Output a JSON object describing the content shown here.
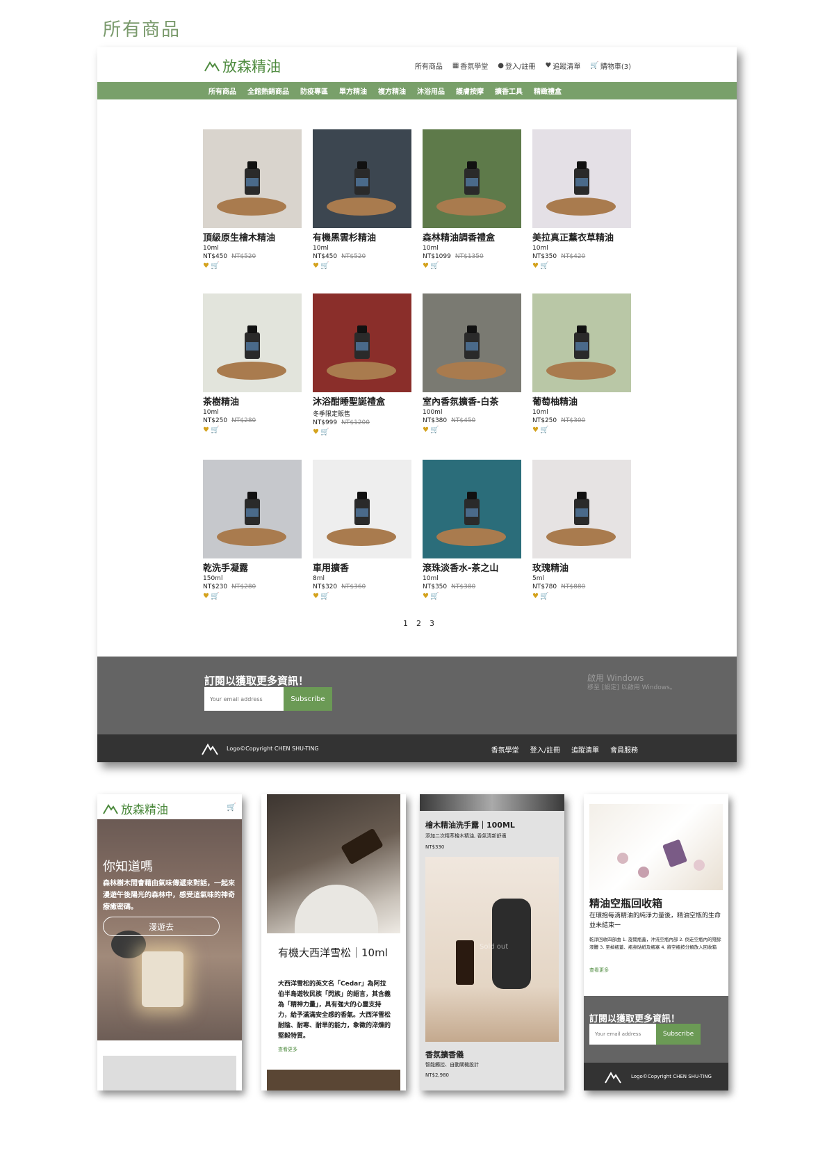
{
  "heading": "所有商品",
  "brand": {
    "logo_text": "放森精油",
    "accent": "#79a06a",
    "logo_color": "#4d8a3e"
  },
  "desktop": {
    "top_links": [
      {
        "label": "所有商品",
        "icon": ""
      },
      {
        "label": "香氛學堂",
        "icon": "store-icon"
      },
      {
        "label": "登入/註冊",
        "icon": "user-icon"
      },
      {
        "label": "追蹤清單",
        "icon": "heart-icon"
      },
      {
        "label": "購物車(3)",
        "icon": "cart-icon"
      }
    ],
    "categories": [
      "所有商品",
      "全館熱銷商品",
      "防疫專區",
      "單方精油",
      "複方精油",
      "沐浴用品",
      "護膚按摩",
      "擴香工具",
      "精緻禮盒"
    ],
    "products": [
      {
        "name": "頂級原生檜木精油",
        "size": "10ml",
        "price": "NT$450",
        "old_price": "NT$520",
        "bg": "#d9d4cd"
      },
      {
        "name": "有機黑雲杉精油",
        "size": "10ml",
        "price": "NT$450",
        "old_price": "NT$520",
        "bg": "#3c4650"
      },
      {
        "name": "森林精油調香禮盒",
        "size": "10ml",
        "price": "NT$1099",
        "old_price": "NT$1350",
        "bg": "#5e7a4a"
      },
      {
        "name": "美拉真正薰衣草精油",
        "size": "10ml",
        "price": "NT$350",
        "old_price": "NT$420",
        "bg": "#e4e0e6"
      },
      {
        "name": "茶樹精油",
        "size": "10ml",
        "price": "NT$250",
        "old_price": "NT$280",
        "bg": "#e2e4dc"
      },
      {
        "name": "沐浴酣睡聖誕禮盒",
        "size": "冬季限定販售",
        "price": "NT$999",
        "old_price": "NT$1200",
        "bg": "#8a2e2a"
      },
      {
        "name": "室內香氛擴香-白茶",
        "size": "100ml",
        "price": "NT$380",
        "old_price": "NT$450",
        "bg": "#7a7a72"
      },
      {
        "name": "葡萄柚精油",
        "size": "10ml",
        "price": "NT$250",
        "old_price": "NT$300",
        "bg": "#b9c7a6"
      },
      {
        "name": "乾洗手凝露",
        "size": "150ml",
        "price": "NT$230",
        "old_price": "NT$280",
        "bg": "#c6c8cc"
      },
      {
        "name": "車用擴香",
        "size": "8ml",
        "price": "NT$320",
        "old_price": "NT$360",
        "bg": "#eeeeee"
      },
      {
        "name": "滾珠淡香水-茶之山",
        "size": "10ml",
        "price": "NT$350",
        "old_price": "NT$380",
        "bg": "#2b6d7a"
      },
      {
        "name": "玫瑰精油",
        "size": "5ml",
        "price": "NT$780",
        "old_price": "NT$880",
        "bg": "#e6e3e3"
      }
    ],
    "pages": [
      "1",
      "2",
      "3"
    ],
    "subscribe": {
      "title": "訂閱以獲取更多資訊！",
      "placeholder": "Your email address",
      "button": "Subscribe"
    },
    "footer": {
      "copyright": "Logo©Copyright CHEN SHU-TING",
      "links": [
        "香氛學堂",
        "登入/註冊",
        "追蹤清單",
        "會員服務"
      ]
    },
    "watermark": {
      "line1": "啟用 Windows",
      "line2": "移至 [設定] 以啟用 Windows。"
    }
  },
  "mobile": {
    "m1": {
      "title": "你知道嗎",
      "text": "森林樹木間會藉由氣味傳遞來對話，一起來漫遊午後陽光的森林中，感受這氣味的神奇療癒密碼。",
      "button": "漫遊去"
    },
    "m2": {
      "title": "有機大西洋雪松｜10ml",
      "desc": "大西洋雪松的英文名「Cedar」為阿拉伯半島遊牧民族「閃族」的語言，其含義為「精神力量」，具有強大的心靈支持力，給予滿滿安全感的香氣。大西洋雪松耐陰、耐寒、耐旱的能力，象徵的淬煉的堅毅特質。",
      "more": "查看更多"
    },
    "m3": {
      "name": "檜木精油洗手露｜100ML",
      "desc": "添加二次精萃檜木精油, 香氣清新舒適",
      "price": "NT$330",
      "soldout": "Sold out",
      "name2": "香氛擴香儀",
      "desc2": "智能觸控、自動關機設計",
      "price2": "NT$2,980"
    },
    "m4": {
      "title": "精油空瓶回收箱",
      "text": "在環抱每滴精油的純淨力量後，精油空瓶的生命並未結束一",
      "steps": "乾淨回收四部曲 1. 旋開瓶蓋，沖洗空瓶內部 2. 倒走空瓶內的殘餘液體 3. 至掉瓶蓋、瓶身貼紙及瓶塞 4. 將空瓶按分類放入回收箱",
      "more": "查看更多",
      "sub_title": "訂閱以獲取更多資訊！",
      "placeholder": "Your email address",
      "button": "Subscribe",
      "copyright": "Logo©Copyright CHEN SHU-TING"
    }
  }
}
